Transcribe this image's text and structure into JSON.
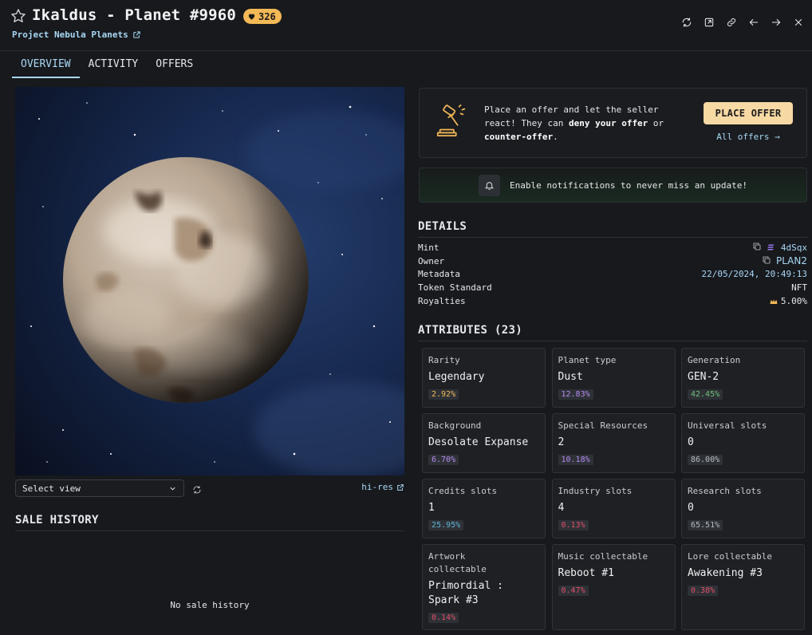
{
  "header": {
    "title": "Ikaldus - Planet #9960",
    "badge": "326",
    "collection": "Project Nebula Planets"
  },
  "tabs": [
    {
      "label": "OVERVIEW",
      "active": true
    },
    {
      "label": "ACTIVITY",
      "active": false
    },
    {
      "label": "OFFERS",
      "active": false
    }
  ],
  "media": {
    "select_view": "Select view",
    "hires": "hi-res"
  },
  "sale_history": {
    "title": "SALE HISTORY",
    "empty": "No sale history"
  },
  "offer": {
    "text_1": "Place an offer and let the seller react! They can ",
    "text_bold_1": "deny your offer",
    "text_2": " or ",
    "text_bold_2": "counter-offer",
    "text_3": ".",
    "button": "PLACE OFFER",
    "all_offers": "All offers →"
  },
  "notify": {
    "text": "Enable notifications to never miss an update!"
  },
  "details": {
    "title": "DETAILS",
    "rows": [
      {
        "label": "Mint",
        "value": "4dSqx"
      },
      {
        "label": "Owner",
        "value": "PLAN2"
      },
      {
        "label": "Metadata",
        "value": "22/05/2024, 20:49:13"
      },
      {
        "label": "Token Standard",
        "value": "NFT"
      },
      {
        "label": "Royalties",
        "value": "5.00%"
      }
    ]
  },
  "attributes": {
    "title": "ATTRIBUTES (23)",
    "items": [
      {
        "name": "Rarity",
        "value": "Legendary",
        "pct": "2.92%",
        "color": "#f3b956"
      },
      {
        "name": "Planet type",
        "value": "Dust",
        "pct": "12.83%",
        "color": "#b58cf2"
      },
      {
        "name": "Generation",
        "value": "GEN-2",
        "pct": "42.45%",
        "color": "#6fbf7a"
      },
      {
        "name": "Background",
        "value": "Desolate Expanse",
        "pct": "6.70%",
        "color": "#b58cf2"
      },
      {
        "name": "Special Resources",
        "value": "2",
        "pct": "10.18%",
        "color": "#b58cf2"
      },
      {
        "name": "Universal slots",
        "value": "0",
        "pct": "86.00%",
        "color": "#b8bcc1"
      },
      {
        "name": "Credits slots",
        "value": "1",
        "pct": "25.95%",
        "color": "#5fb7d9"
      },
      {
        "name": "Industry slots",
        "value": "4",
        "pct": "0.13%",
        "color": "#e0506a"
      },
      {
        "name": "Research slots",
        "value": "0",
        "pct": "65.51%",
        "color": "#b8bcc1"
      },
      {
        "name": "Artwork collectable",
        "value": "Primordial : Spark #3",
        "pct": "0.14%",
        "color": "#e0506a"
      },
      {
        "name": "Music collectable",
        "value": "Reboot #1",
        "pct": "0.47%",
        "color": "#e0506a"
      },
      {
        "name": "Lore collectable",
        "value": "Awakening #3",
        "pct": "0.38%",
        "color": "#e0506a"
      }
    ]
  }
}
